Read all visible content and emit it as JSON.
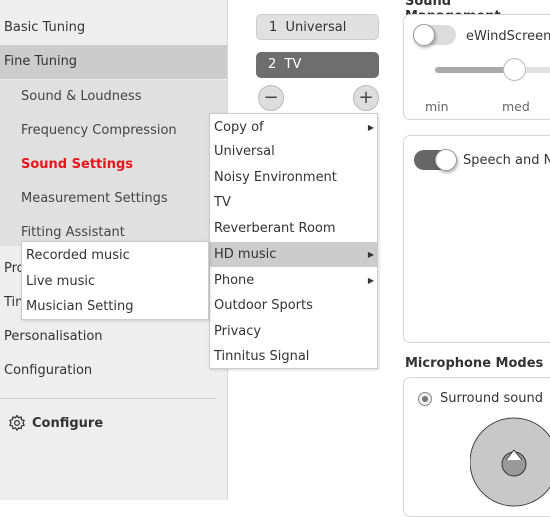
{
  "sidebar": {
    "items": [
      "Basic Tuning",
      "Fine Tuning"
    ],
    "sub_items": [
      "Sound & Loudness",
      "Frequency Compression",
      "Sound Settings",
      "Measurement Settings",
      "Fitting Assistant"
    ],
    "lower_items": [
      "Pro",
      "Tin",
      "Personalisation",
      "Configuration"
    ],
    "configure": "Configure"
  },
  "programs": [
    {
      "num": "1",
      "name": "Universal"
    },
    {
      "num": "2",
      "name": "TV"
    }
  ],
  "context_menu": {
    "items": [
      "Copy of",
      "Universal",
      "Noisy Environment",
      "TV",
      "Reverberant Room",
      "HD music",
      "Phone",
      "Outdoor Sports",
      "Privacy",
      "Tinnitus Signal"
    ]
  },
  "submenu": {
    "items": [
      "Recorded music",
      "Live music",
      "Musician Setting"
    ]
  },
  "sound_management": {
    "title": "Sound Management",
    "ewindscreen": "eWindScreen",
    "slider_labels": [
      "min",
      "med"
    ],
    "slider_value": "med",
    "speech": "Speech and No"
  },
  "microphone_modes": {
    "title": "Microphone Modes",
    "option": "Surround sound"
  },
  "colors": {
    "accent": "#e8141c",
    "selected_program": "#6e6e6e"
  }
}
